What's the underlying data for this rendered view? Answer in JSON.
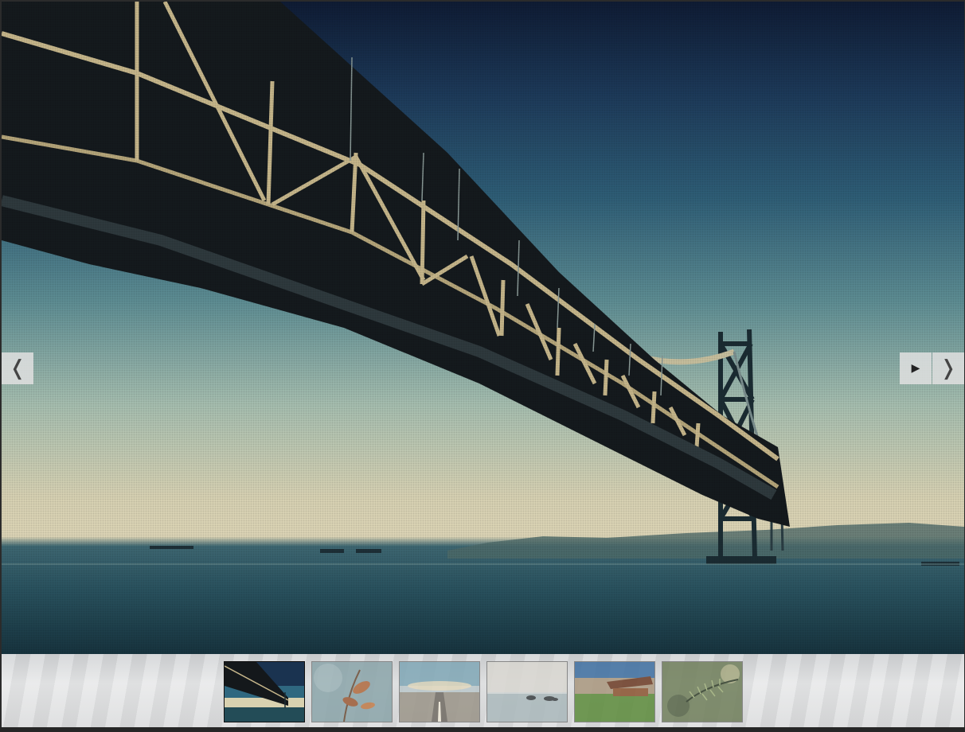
{
  "gallery": {
    "main_slide": {
      "subject": "suspension-bridge-over-sea",
      "index": 1,
      "total": 6
    },
    "controls": {
      "prev": "❬",
      "play": "▶",
      "next": "❭"
    },
    "thumbnails": [
      {
        "subject": "suspension-bridge",
        "active": true
      },
      {
        "subject": "dried-leaves",
        "active": false
      },
      {
        "subject": "road-to-horizon",
        "active": false
      },
      {
        "subject": "rocks-in-calm-sea",
        "active": false
      },
      {
        "subject": "wooden-hut-on-grass",
        "active": false
      },
      {
        "subject": "pine-branch-bokeh",
        "active": false
      }
    ]
  },
  "colors": {
    "sky_top": "#0f1c35",
    "horizon": "#dfd7b8",
    "sea": "#2a5360",
    "strip": "#e6e7e8",
    "button": "#e1e1e1"
  }
}
